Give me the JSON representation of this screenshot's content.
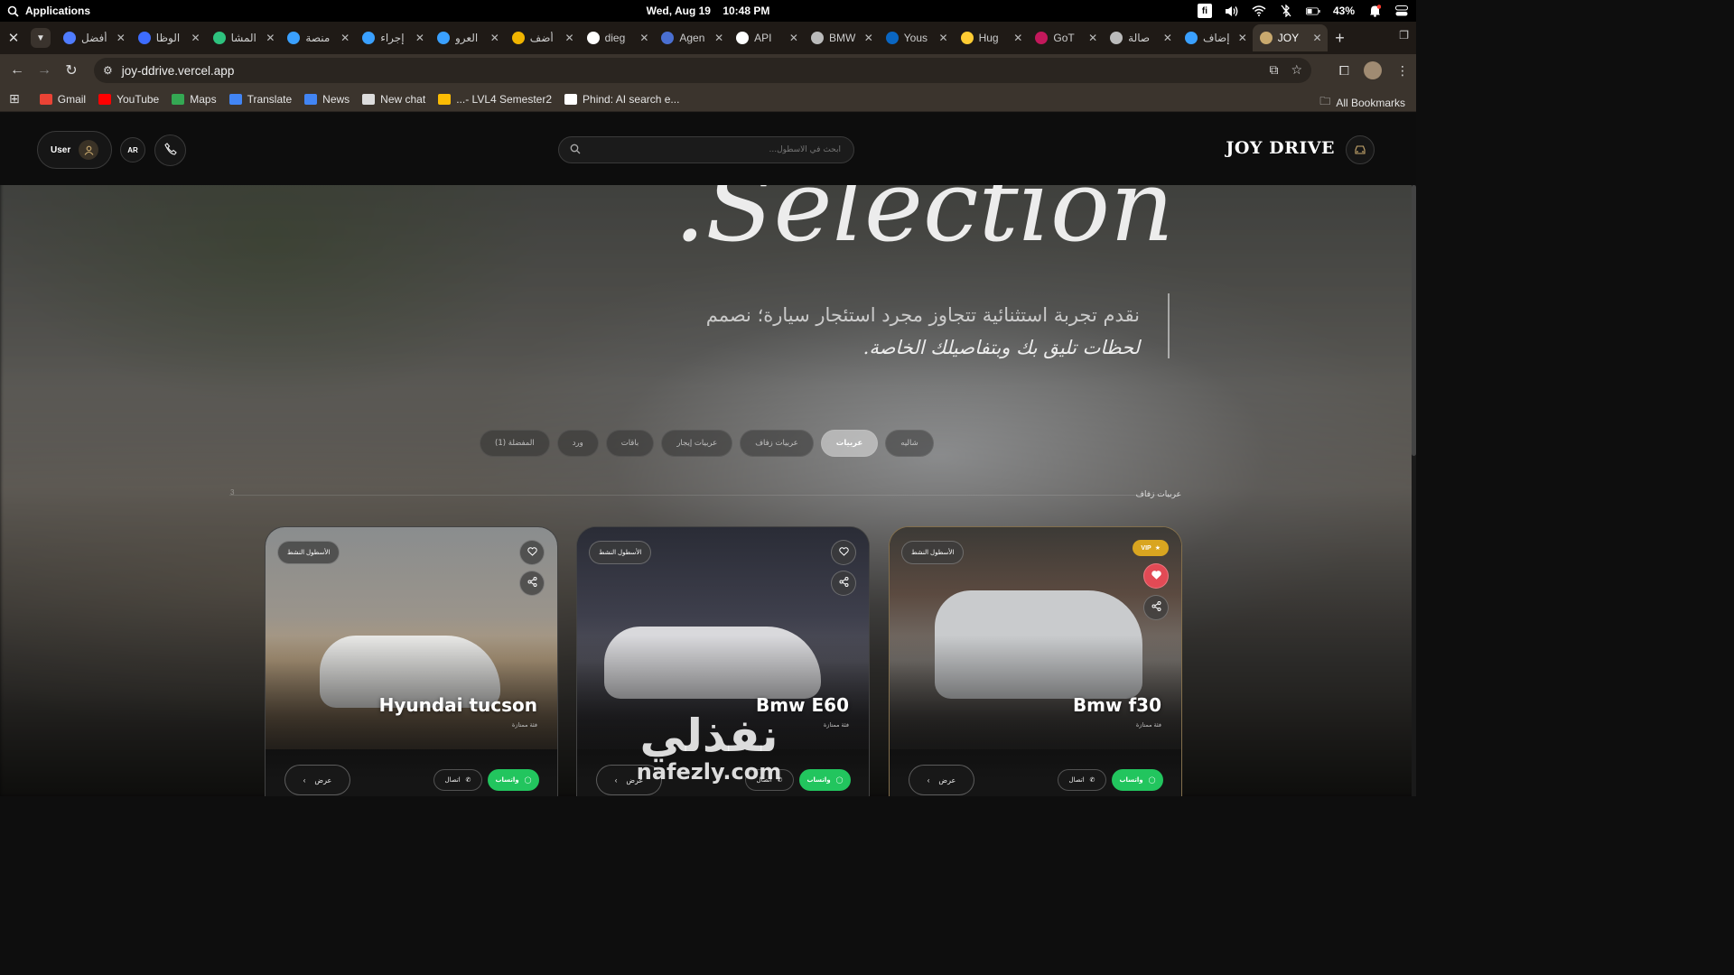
{
  "os": {
    "menu": "Applications",
    "date": "Wed, Aug 19",
    "time": "10:48 PM",
    "input_badge": "fi",
    "battery": "43%"
  },
  "browser": {
    "tabs": [
      {
        "title": "أفضل",
        "icon": "gemini-icon",
        "color": "#4f7cff"
      },
      {
        "title": "الوظا",
        "icon": "shield-icon",
        "color": "#3d6cff"
      },
      {
        "title": "المشا",
        "icon": "k-icon",
        "color": "#2ec27e"
      },
      {
        "title": "منصة",
        "icon": "circle-o-icon",
        "color": "#3aa0ff"
      },
      {
        "title": "إجراء",
        "icon": "circle-o-icon",
        "color": "#3aa0ff"
      },
      {
        "title": "العرو",
        "icon": "circle-o-icon",
        "color": "#3aa0ff"
      },
      {
        "title": "أضف",
        "icon": "s-icon",
        "color": "#f0b400"
      },
      {
        "title": "dieg",
        "icon": "github-icon",
        "color": "#ffffff"
      },
      {
        "title": "Agen",
        "icon": "a-icon",
        "color": "#4a6fd1"
      },
      {
        "title": "API",
        "icon": "api-icon",
        "color": "#ffffff"
      },
      {
        "title": "BMW",
        "icon": "globe-icon",
        "color": "#bbbbbb"
      },
      {
        "title": "Yous",
        "icon": "linkedin-icon",
        "color": "#0a66c2"
      },
      {
        "title": "Hug",
        "icon": "hf-icon",
        "color": "#ffcc33"
      },
      {
        "title": "GoT",
        "icon": "g-icon",
        "color": "#c2185b"
      },
      {
        "title": "صالة",
        "icon": "globe-icon",
        "color": "#bbbbbb"
      },
      {
        "title": "إضاف",
        "icon": "swirl-icon",
        "color": "#3aa0ff"
      },
      {
        "title": "JOY",
        "icon": "z-icon",
        "color": "#c9a96e",
        "active": true
      }
    ],
    "url": "joy-ddrive.vercel.app",
    "bookmarks": [
      {
        "label": "Gmail",
        "icon": "gmail-icon",
        "color": "#ea4335"
      },
      {
        "label": "YouTube",
        "icon": "youtube-icon",
        "color": "#ff0000"
      },
      {
        "label": "Maps",
        "icon": "maps-icon",
        "color": "#34a853"
      },
      {
        "label": "Translate",
        "icon": "translate-icon",
        "color": "#4285f4"
      },
      {
        "label": "News",
        "icon": "news-icon",
        "color": "#4285f4"
      },
      {
        "label": "New chat",
        "icon": "chat-icon",
        "color": "#dddddd"
      },
      {
        "label": "...- LVL4 Semester2",
        "icon": "drive-icon",
        "color": "#fbbc04"
      },
      {
        "label": "Phind: AI search e...",
        "icon": "phind-icon",
        "color": "#ffffff"
      }
    ],
    "all_bookmarks": "All Bookmarks"
  },
  "site": {
    "brand": "JOY DRIVE",
    "user_label": "User",
    "lang_label": "AR",
    "search_placeholder": "ابحث في الأسطول...",
    "hero_word": ".Selection",
    "tagline_line1": "نقدم تجربة استثنائية تتجاوز مجرد استئجار سيارة؛ نصمم",
    "tagline_line2": "لحظات تليق بك وبتفاصيلك الخاصة.",
    "filters": [
      "المفضلة (1)",
      "ورد",
      "باقات",
      "عربيات إيجار",
      "عربيات زفاف",
      "عربيات",
      "شاليه"
    ],
    "active_filter_index": 5,
    "breadcrumb": "عربيات زفاف",
    "page_marker": "3",
    "cards": [
      {
        "title": "Hyundai tucson",
        "subtitle": "فئة ممتازة",
        "status": "الأسطول النشط",
        "view": "عرض",
        "call": "اتصال",
        "whatsapp": "واتساب",
        "vip": false,
        "favorited": false
      },
      {
        "title": "Bmw E60",
        "subtitle": "فئة ممتازة",
        "status": "الأسطول النشط",
        "view": "عرض",
        "call": "اتصال",
        "whatsapp": "واتساب",
        "vip": false,
        "favorited": false
      },
      {
        "title": "Bmw f30",
        "subtitle": "فئة ممتازة",
        "status": "الأسطول النشط",
        "view": "عرض",
        "call": "اتصال",
        "whatsapp": "واتساب",
        "vip": true,
        "vip_label": "VIP",
        "favorited": true
      }
    ],
    "watermark_ar": "نفذلي",
    "watermark_en": "nafezly.com",
    "accent_color": "#c9a96e",
    "whatsapp_color": "#22c55e"
  }
}
